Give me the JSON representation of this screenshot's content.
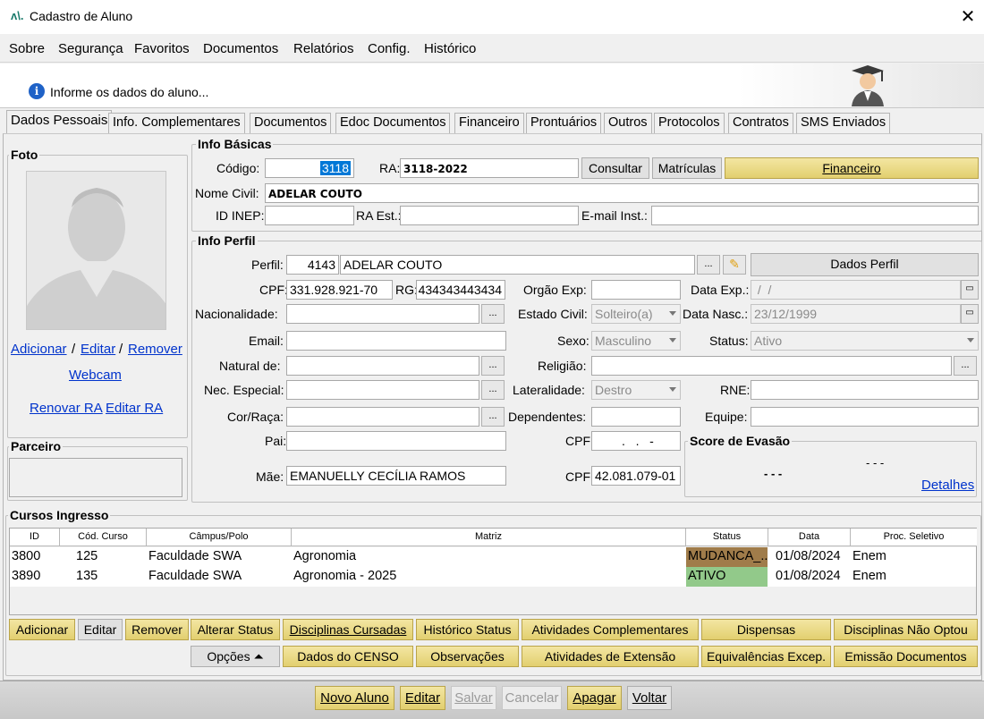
{
  "window": {
    "title": "Cadastro de Aluno",
    "logo": "ʌ\\."
  },
  "menu": [
    "Sobre",
    "Segurança",
    "Favoritos",
    "Documentos",
    "Relatórios",
    "Config.",
    "Histórico"
  ],
  "info": {
    "message": "Informe os dados do aluno...",
    "icon": "info-icon"
  },
  "tabs": [
    "Dados Pessoais",
    "Info. Complementares",
    "Documentos",
    "Edoc Documentos",
    "Financeiro",
    "Prontuários",
    "Outros",
    "Protocolos",
    "Contratos",
    "SMS Enviados"
  ],
  "foto": {
    "title": "Foto",
    "adicionar": "Adicionar",
    "editar": "Editar",
    "remover": "Remover",
    "sep": "/",
    "webcam": "Webcam",
    "renovar_ra": "Renovar RA",
    "editar_ra": "Editar RA"
  },
  "parceiro": {
    "title": "Parceiro"
  },
  "basicas": {
    "title": "Info Básicas",
    "codigo_label": "Código:",
    "codigo": "3118",
    "ra_label": "RA:",
    "ra": "3118-2022",
    "consultar": "Consultar",
    "matriculas": "Matrículas",
    "financeiro": "Financeiro",
    "nome_civil_label": "Nome Civil:",
    "nome_civil": "ADELAR COUTO",
    "id_inep_label": "ID INEP:",
    "ra_est_label": "RA Est.:",
    "email_inst_label": "E-mail Inst.:"
  },
  "perfil": {
    "title": "Info Perfil",
    "perfil_label": "Perfil:",
    "perfil_id": "4143",
    "perfil_nome": "ADELAR COUTO",
    "dados_perfil": "Dados Perfil",
    "cpf_label": "CPF:",
    "cpf": "331.928.921-70",
    "rg_label": "RG:",
    "rg": "434343443434",
    "orgao_exp_label": "Orgão Exp:",
    "data_exp_label": "Data Exp.:",
    "data_exp": " /  /",
    "nacionalidade_label": "Nacionalidade:",
    "estado_civil_label": "Estado Civil:",
    "estado_civil": "Solteiro(a)",
    "data_nasc_label": "Data Nasc.:",
    "data_nasc": "23/12/1999",
    "email_label": "Email:",
    "sexo_label": "Sexo:",
    "sexo": "Masculino",
    "status_label": "Status:",
    "status": "Ativo",
    "natural_label": "Natural de:",
    "religiao_label": "Religião:",
    "nec_especial_label": "Nec. Especial:",
    "lateralidade_label": "Lateralidade:",
    "lateralidade": "Destro",
    "rne_label": "RNE:",
    "cor_raca_label": "Cor/Raça:",
    "dependentes_label": "Dependentes:",
    "equipe_label": "Equipe:",
    "pai_label": "Pai:",
    "cpf_pai_label": "CPF:",
    "cpf_pai": " .   .   -",
    "mae_label": "Mãe:",
    "mae": "EMANUELLY CECÍLIA RAMOS",
    "cpf_mae_label": "CPF:",
    "cpf_mae": "42.081.079-01",
    "ellipsis": "...",
    "score_title": "Score de Evasão",
    "score_value": "- - -",
    "score_value2": "- - -",
    "detalhes": "Detalhes"
  },
  "cursos": {
    "title": "Cursos Ingresso",
    "columns": [
      "ID",
      "Cód. Curso",
      "Câmpus/Polo",
      "Matriz",
      "Status",
      "Data",
      "Proc. Seletivo"
    ],
    "rows": [
      {
        "id": "3800",
        "cod": "125",
        "campus": "Faculdade SWA",
        "matriz": "Agronomia",
        "status": "MUDANCA_...",
        "data": "01/08/2024",
        "proc": "Enem",
        "status_color": "#a07c4a"
      },
      {
        "id": "3890",
        "cod": "135",
        "campus": "Faculdade SWA",
        "matriz": "Agronomia - 2025",
        "status": "ATIVO",
        "data": "01/08/2024",
        "proc": "Enem",
        "status_color": "#92c98a"
      }
    ]
  },
  "actions1": [
    "Adicionar",
    "Editar",
    "Remover",
    "Alterar Status",
    "Disciplinas Cursadas",
    "Histórico Status",
    "Atividades Complementares",
    "Dispensas",
    "Disciplinas Não Optou"
  ],
  "actions2": [
    "Opções ⏶",
    "Dados do CENSO",
    "Observações",
    "Atividades de Extensão",
    "Equivalências Excep.",
    "Emissão Documentos"
  ],
  "footer": [
    "Novo Aluno",
    "Editar",
    "Salvar",
    "Cancelar",
    "Apagar",
    "Voltar"
  ]
}
